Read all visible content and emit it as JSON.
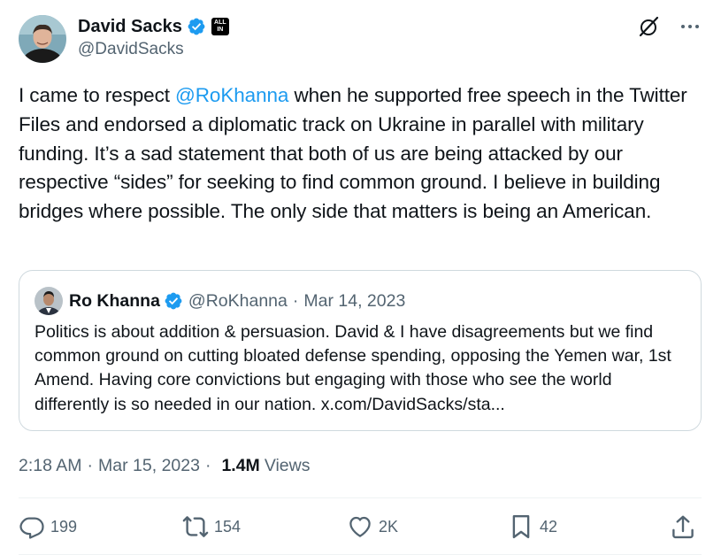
{
  "author": {
    "name": "David Sacks",
    "handle": "@DavidSacks",
    "affiliate_badge": [
      "ALL",
      "IN"
    ]
  },
  "tweet": {
    "mention": "@RoKhanna",
    "text_before": "I came to respect ",
    "text_after": " when he supported free speech in the Twitter Files and endorsed a diplomatic track on Ukraine in parallel with military funding. It’s a sad statement that both of us are being attacked by our respective “sides” for seeking to find common ground. I believe in building bridges where possible. The only side that matters is being an American."
  },
  "quoted": {
    "name": "Ro Khanna",
    "handle": "@RoKhanna",
    "separator": "·",
    "date": "Mar 14, 2023",
    "text": "Politics is about addition & persuasion. David & I have disagreements but we find common ground on cutting bloated defense spending, opposing the Yemen war, 1st Amend. Having core convictions but engaging with those who see the world differently is so needed in our nation. x.com/DavidSacks/sta..."
  },
  "meta": {
    "time": "2:18 AM",
    "separator": "·",
    "date": "Mar 15, 2023",
    "views_count": "1.4M",
    "views_label": "Views"
  },
  "actions": {
    "replies": "199",
    "reposts": "154",
    "likes": "2K",
    "bookmarks": "42"
  },
  "icons": {
    "top_right": [
      "grok-icon",
      "more-icon"
    ],
    "actions": [
      "reply-icon",
      "repost-icon",
      "like-icon",
      "bookmark-icon",
      "share-icon"
    ]
  },
  "colors": {
    "accent": "#1d9bf0",
    "text": "#0f1419",
    "secondary": "#536471",
    "border": "#cfd9de"
  }
}
